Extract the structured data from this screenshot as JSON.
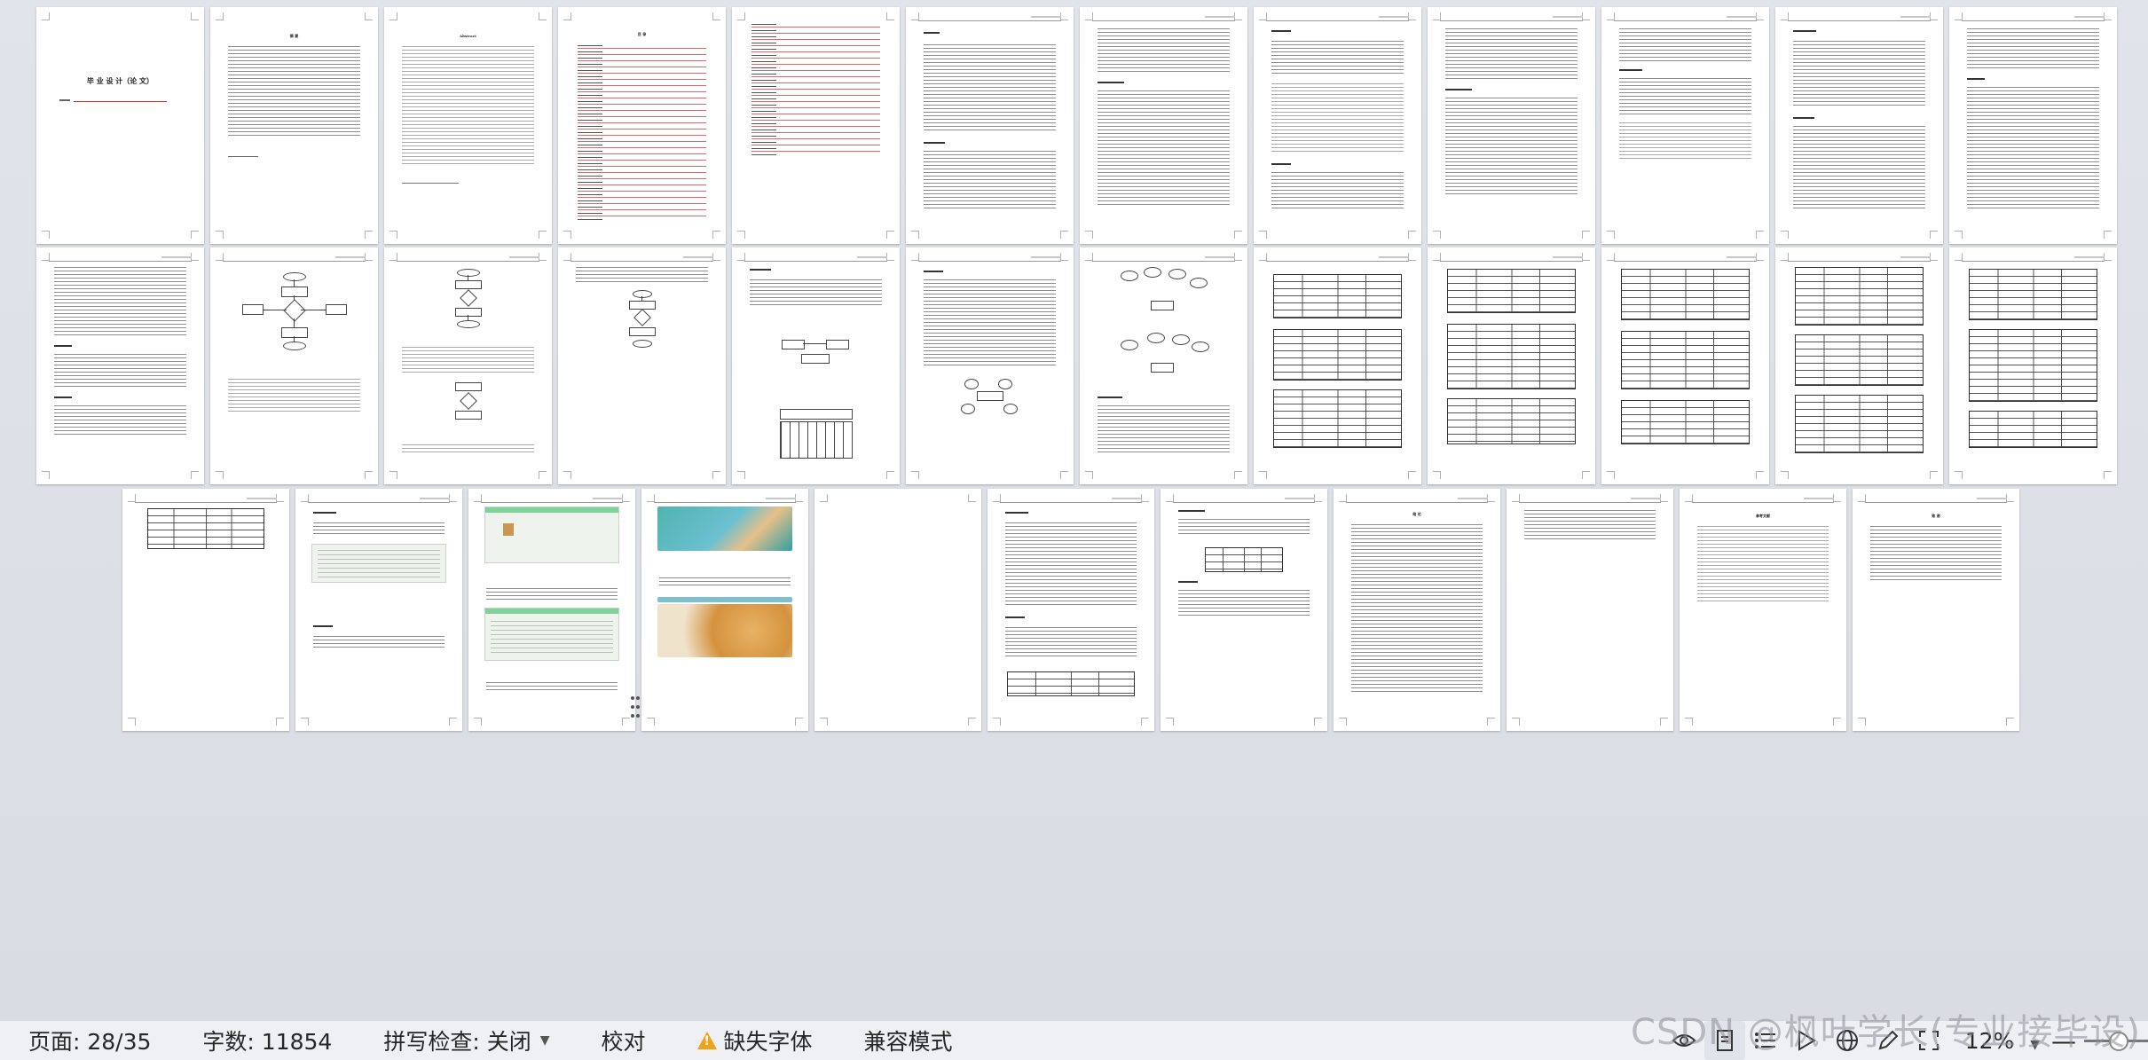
{
  "document": {
    "cover_title": "毕 业 设 计（论 文）",
    "abstract_heading": "摘 要",
    "abstract_heading_en": "Abstract",
    "toc_heading": "目 录",
    "thanks_heading": "致 谢",
    "references_heading": "参考文献",
    "conclusion_heading": "结 论"
  },
  "statusbar": {
    "page": "页面: 28/35",
    "word_count": "字数: 11854",
    "spellcheck": "拼写检查: 关闭",
    "proofread": "校对",
    "missing_fonts": "缺失字体",
    "compat_mode": "兼容模式",
    "zoom": "12%"
  },
  "watermark": "CSDN @枫叶学长(专业接毕设)",
  "icons": {
    "eye": "eye-icon",
    "page_view": "page-view-icon",
    "outline": "outline-icon",
    "play": "play-icon",
    "web": "globe-icon",
    "pen": "pen-icon",
    "fit": "fit-window-icon"
  }
}
